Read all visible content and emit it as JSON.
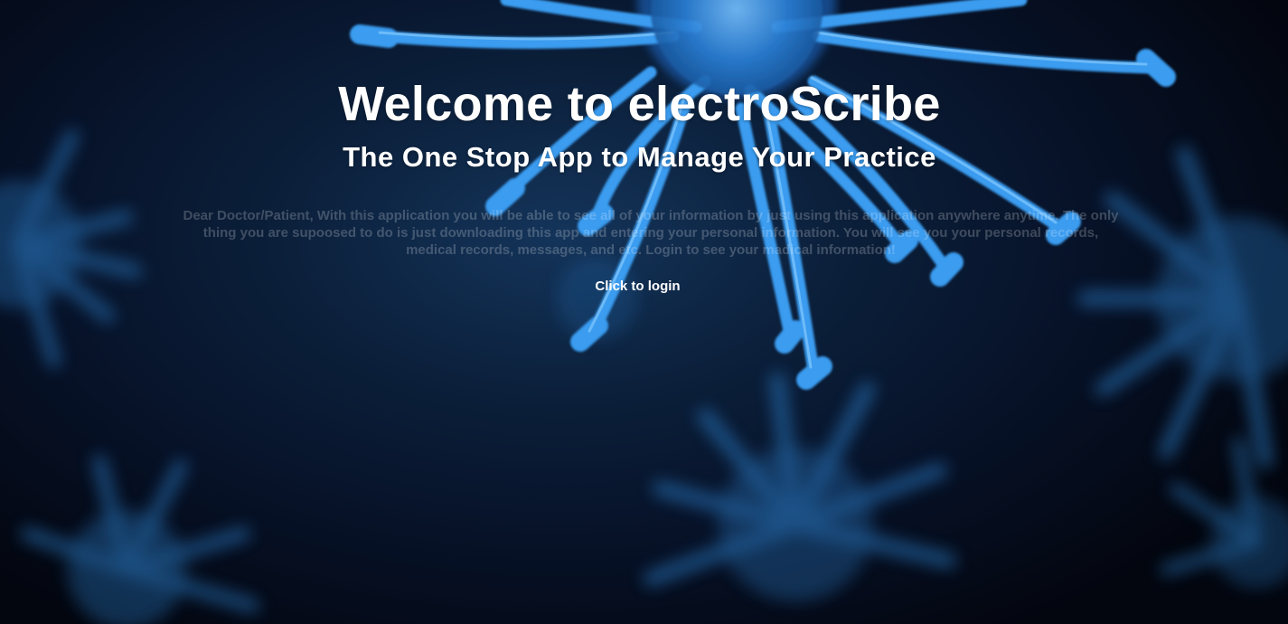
{
  "hero": {
    "title": "Welcome to electroScribe",
    "subtitle": "The One Stop App to Manage Your Practice",
    "intro": "Dear Doctor/Patient, With this application you will be able to see all of your information by just using this application anywhere anytime. The only thing you are supoosed to do is just downloading this app and entering your personal information. You will see you your personal records, medical records, messages, and etc. Login to see your madical information!",
    "login_link": "Click to login"
  },
  "background": {
    "image": "virus-illustration",
    "colors": {
      "base": "#050a18",
      "glow": "#14345a",
      "virus_bright": "#3a9be8",
      "virus_core": "#1f6fc0"
    }
  }
}
